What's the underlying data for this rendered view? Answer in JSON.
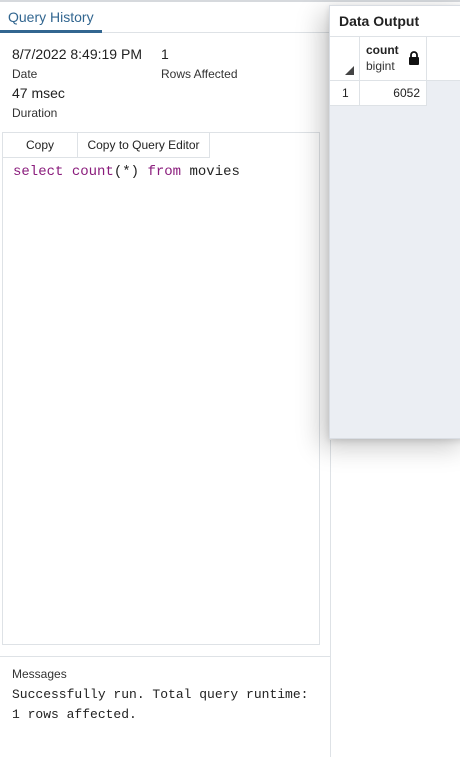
{
  "tabs": {
    "query_history": "Query History"
  },
  "history": {
    "date_value": "8/7/2022 8:49:19 PM",
    "date_label": "Date",
    "rows_value": "1",
    "rows_label": "Rows Affected",
    "duration_value": "47 msec",
    "duration_label": "Duration"
  },
  "query_box": {
    "copy_label": "Copy",
    "copy_editor_label": "Copy to Query Editor",
    "sql": {
      "kw1": "select",
      "fn": "count",
      "args": "(*)",
      "kw2": "from",
      "table": "movies"
    }
  },
  "messages": {
    "title": "Messages",
    "line1": "Successfully run. Total query runtime:",
    "line2": "1 rows affected."
  },
  "data_output": {
    "title": "Data Output",
    "column": {
      "name": "count",
      "type": "bigint"
    },
    "rows": [
      {
        "row_num": "1",
        "value": "6052"
      }
    ]
  },
  "colors": {
    "accent": "#326690",
    "keyword": "#8a1c7c"
  }
}
